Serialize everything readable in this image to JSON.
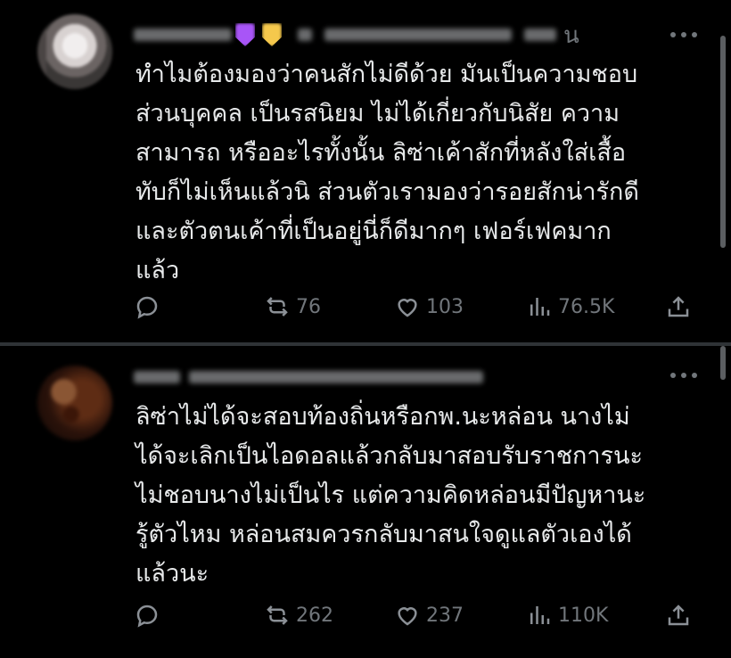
{
  "posts": [
    {
      "header": {
        "handle_suffix": "น",
        "badges": [
          {
            "color": "#a855f7"
          },
          {
            "color": "#f5c84c"
          }
        ]
      },
      "lines": [
        "ทำไมต้องมองว่าคนสักไม่ดีด้วย มันเป็นความชอบ",
        "ส่วนบุคคล เป็นรสนิยม ไม่ได้เกี่ยวกับนิสัย ความ",
        "สามารถ หรืออะไรทั้งนั้น  ลิซ่าเค้าสักที่หลังใส่เสื้อ",
        "ทับก็ไม่เห็นแล้วนิ ส่วนตัวเรามองว่ารอยสักน่ารักดี",
        "และตัวตนเค้าที่เป็นอยู่นี่ก็ดีมากๆ เฟอร์เฟคมาก",
        "แล้ว"
      ],
      "stats": {
        "reposts": "76",
        "likes": "103",
        "views": "76.5K"
      }
    },
    {
      "header": {
        "handle_suffix": "",
        "badges": []
      },
      "lines": [
        "ลิซ่าไม่ได้จะสอบท้องถิ่นหรือกพ.นะหล่อน  นางไม่",
        "ได้จะเลิกเป็นไอดอลแล้วกลับมาสอบรับราชการนะ",
        "ไม่ชอบนางไม่เป็นไร แต่ความคิดหล่อนมีปัญหานะ",
        "รู้ตัวไหม หล่อนสมควรกลับมาสนใจดูแลตัวเองได้",
        "แล้วนะ"
      ],
      "stats": {
        "reposts": "262",
        "likes": "237",
        "views": "110K"
      }
    }
  ],
  "icons": {
    "reply": "reply-icon",
    "repost": "repost-icon",
    "like": "heart-icon",
    "views": "analytics-icon",
    "share": "share-icon",
    "more": "more-icon"
  },
  "colors": {
    "background": "#000000",
    "text": "#e7e9ea",
    "muted": "#71767b",
    "divider": "#2f3336"
  }
}
